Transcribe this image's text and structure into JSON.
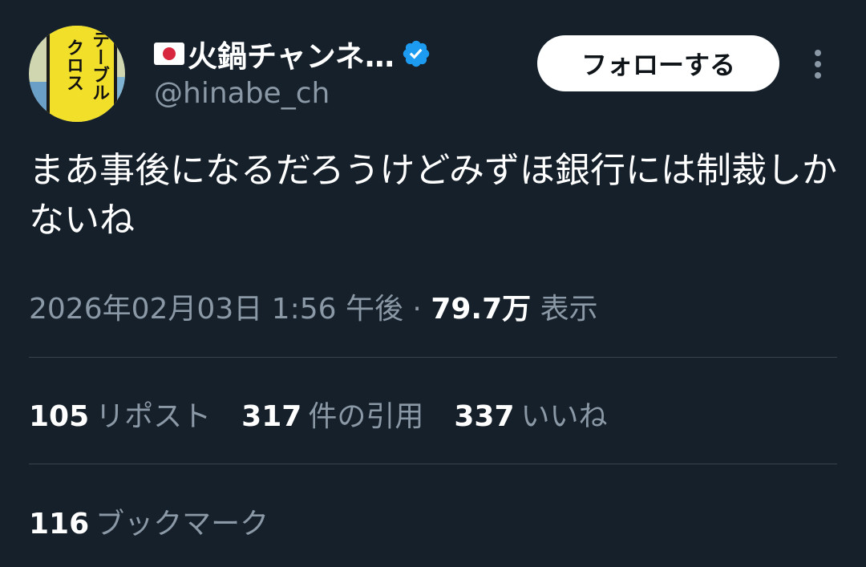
{
  "author": {
    "display_name": "火鍋チャンネ…",
    "handle": "@hinabe_ch",
    "verified_color": "#1d9bf0",
    "avatar_text_col1": "テーブル",
    "avatar_text_col2": "クロス"
  },
  "actions": {
    "follow_label": "フォローする"
  },
  "tweet": {
    "text": "まあ事後になるだろうけどみずほ銀行には制裁しかないね"
  },
  "meta": {
    "datetime": "2026年02月03日 1:56 午後",
    "separator": " · ",
    "views_count": "79.7万",
    "views_label": "表示"
  },
  "stats": {
    "reposts_count": "105",
    "reposts_label": "リポスト",
    "quotes_count": "317",
    "quotes_label": "件の引用",
    "likes_count": "337",
    "likes_label": "いいね",
    "bookmarks_count": "116",
    "bookmarks_label": "ブックマーク"
  },
  "colors": {
    "background": "#15202b",
    "secondary_text": "#8b98a5",
    "divider": "#38444d"
  }
}
